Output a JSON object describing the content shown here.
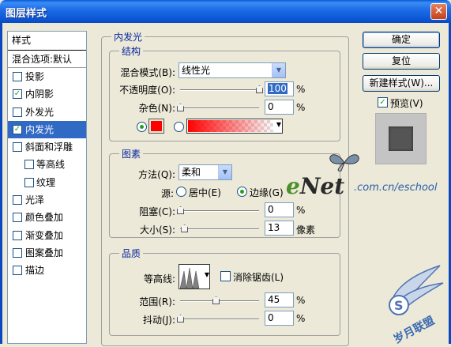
{
  "window": {
    "title": "图层样式",
    "close_glyph": "✕"
  },
  "style_list": {
    "header": "样式",
    "blend_options": "混合选项:默认",
    "items": [
      {
        "label": "投影",
        "checked": false,
        "indent": false,
        "selected": false
      },
      {
        "label": "内阴影",
        "checked": true,
        "indent": false,
        "selected": false
      },
      {
        "label": "外发光",
        "checked": false,
        "indent": false,
        "selected": false
      },
      {
        "label": "内发光",
        "checked": true,
        "indent": false,
        "selected": true
      },
      {
        "label": "斜面和浮雕",
        "checked": false,
        "indent": false,
        "selected": false
      },
      {
        "label": "等高线",
        "checked": false,
        "indent": true,
        "selected": false
      },
      {
        "label": "纹理",
        "checked": false,
        "indent": true,
        "selected": false
      },
      {
        "label": "光泽",
        "checked": false,
        "indent": false,
        "selected": false
      },
      {
        "label": "颜色叠加",
        "checked": false,
        "indent": false,
        "selected": false
      },
      {
        "label": "渐变叠加",
        "checked": false,
        "indent": false,
        "selected": false
      },
      {
        "label": "图案叠加",
        "checked": false,
        "indent": false,
        "selected": false
      },
      {
        "label": "描边",
        "checked": false,
        "indent": false,
        "selected": false
      }
    ]
  },
  "inner_glow": {
    "title": "内发光",
    "structure": {
      "title": "结构",
      "blend_mode_label": "混合模式(B):",
      "blend_mode_value": "线性光",
      "opacity_label": "不透明度(O):",
      "opacity_value": "100",
      "opacity_level": 1.0,
      "noise_label": "杂色(N):",
      "noise_value": "0",
      "noise_level": 0.0,
      "percent": "%",
      "color_swatch": "#ff0000",
      "gradient_from": "#ff0000"
    },
    "elements": {
      "title": "图素",
      "method_label": "方法(Q):",
      "method_value": "柔和",
      "source_label": "源:",
      "source_center": "居中(E)",
      "source_edge": "边缘(G)",
      "choke_label": "阻塞(C):",
      "choke_value": "0",
      "choke_level": 0.0,
      "size_label": "大小(S):",
      "size_value": "13",
      "size_level": 0.052,
      "pixels": "像素",
      "percent": "%"
    },
    "quality": {
      "title": "品质",
      "contour_label": "等高线:",
      "antialias_label": "消除锯齿(L)",
      "range_label": "范围(R):",
      "range_value": "45",
      "range_level": 0.45,
      "jitter_label": "抖动(J):",
      "jitter_value": "0",
      "jitter_level": 0.0,
      "percent": "%"
    }
  },
  "buttons": {
    "ok": "确定",
    "reset": "复位",
    "new_style": "新建样式(W)...",
    "preview_label": "预览(V)",
    "preview_checked": true
  },
  "watermarks": {
    "enet_e": "e",
    "enet_rest": "Net",
    "enet_url": ".com.cn/eschool",
    "yuemeng": "岁月联盟"
  }
}
